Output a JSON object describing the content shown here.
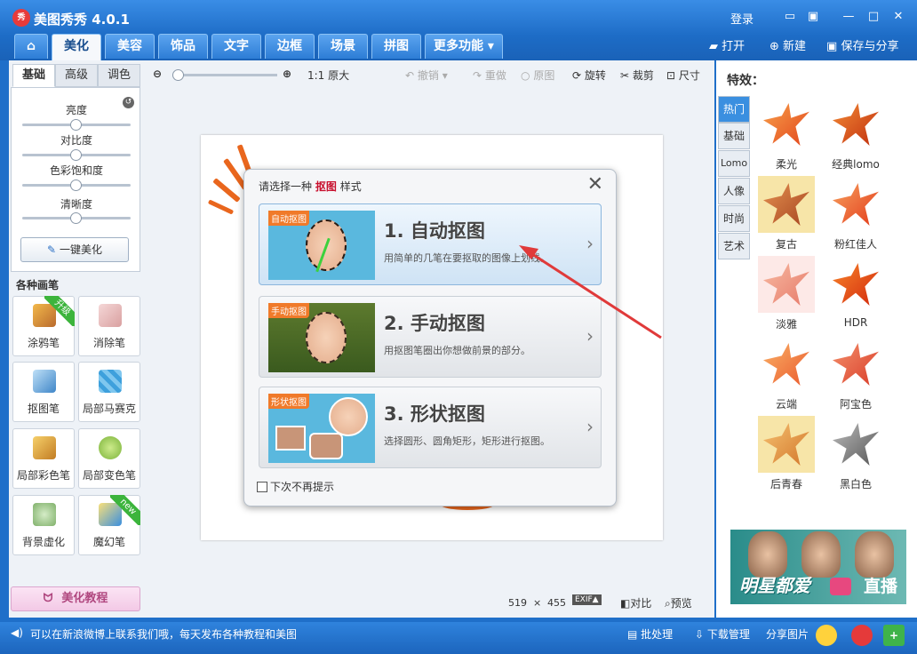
{
  "app": {
    "title": "美图秀秀 4.0.1",
    "logo": "秀"
  },
  "titlebar": {
    "login": "登录"
  },
  "tabs": [
    "美化",
    "美容",
    "饰品",
    "文字",
    "边框",
    "场景",
    "拼图",
    "更多功能"
  ],
  "header_actions": {
    "open": "打开",
    "new": "新建",
    "save_share": "保存与分享"
  },
  "left": {
    "subtabs": [
      "基础",
      "高级",
      "调色"
    ],
    "sliders": [
      {
        "label": "亮度",
        "value": 0.5
      },
      {
        "label": "对比度",
        "value": 0.5
      },
      {
        "label": "色彩饱和度",
        "value": 0.5
      },
      {
        "label": "清晰度",
        "value": 0.5
      }
    ],
    "one_key": "一键美化",
    "brush_section": "各种画笔",
    "brushes": [
      {
        "label": "涂鸦笔",
        "badge": "升级",
        "icon": "paintbrush-icon"
      },
      {
        "label": "消除笔",
        "badge": "",
        "icon": "eraser-icon"
      },
      {
        "label": "抠图笔",
        "badge": "",
        "icon": "cutout-pen-icon"
      },
      {
        "label": "局部马赛克",
        "badge": "",
        "icon": "mosaic-icon"
      },
      {
        "label": "局部彩色笔",
        "badge": "",
        "icon": "color-brush-icon"
      },
      {
        "label": "局部变色笔",
        "badge": "",
        "icon": "recolor-pen-icon"
      },
      {
        "label": "背景虚化",
        "badge": "",
        "icon": "blur-background-icon"
      },
      {
        "label": "魔幻笔",
        "badge": "new",
        "icon": "magic-pen-icon"
      }
    ],
    "tutorial": "美化教程"
  },
  "toolbar": {
    "original_size": "1:1 原大",
    "undo": "撤销",
    "redo": "重做",
    "original": "原图",
    "rotate": "旋转",
    "crop": "裁剪",
    "size": "尺寸"
  },
  "dialog": {
    "title_pre": "请选择一种",
    "title_bold": "抠图",
    "title_post": "样式",
    "options": [
      {
        "tag": "自动抠图",
        "heading": "1. 自动抠图",
        "desc": "用简单的几笔在要抠取的图像上划线。"
      },
      {
        "tag": "手动抠图",
        "heading": "2. 手动抠图",
        "desc": "用抠图笔圈出你想做前景的部分。"
      },
      {
        "tag": "形状抠图",
        "heading": "3. 形状抠图",
        "desc": "选择圆形、圆角矩形，矩形进行抠图。"
      }
    ],
    "no_remind": "下次不再提示"
  },
  "canvas_info": {
    "width": "519",
    "times": "×",
    "height": "455",
    "exif": "EXIF▲",
    "compare": "对比",
    "preview": "预览"
  },
  "effects": {
    "title": "特效：",
    "categories": [
      "热门",
      "基础",
      "Lomo",
      "人像",
      "时尚",
      "艺术"
    ],
    "items": [
      {
        "label": "柔光"
      },
      {
        "label": "经典lomo"
      },
      {
        "label": "复古"
      },
      {
        "label": "粉红佳人"
      },
      {
        "label": "淡雅"
      },
      {
        "label": "HDR"
      },
      {
        "label": "云端"
      },
      {
        "label": "阿宝色"
      },
      {
        "label": "后青春"
      },
      {
        "label": "黑白色"
      }
    ],
    "ad": {
      "text": "明星都爱",
      "cta": "直播"
    }
  },
  "status": {
    "message": "可以在新浪微博上联系我们哦，每天发布各种教程和美图",
    "batch": "批处理",
    "download": "下载管理",
    "share": "分享图片"
  }
}
